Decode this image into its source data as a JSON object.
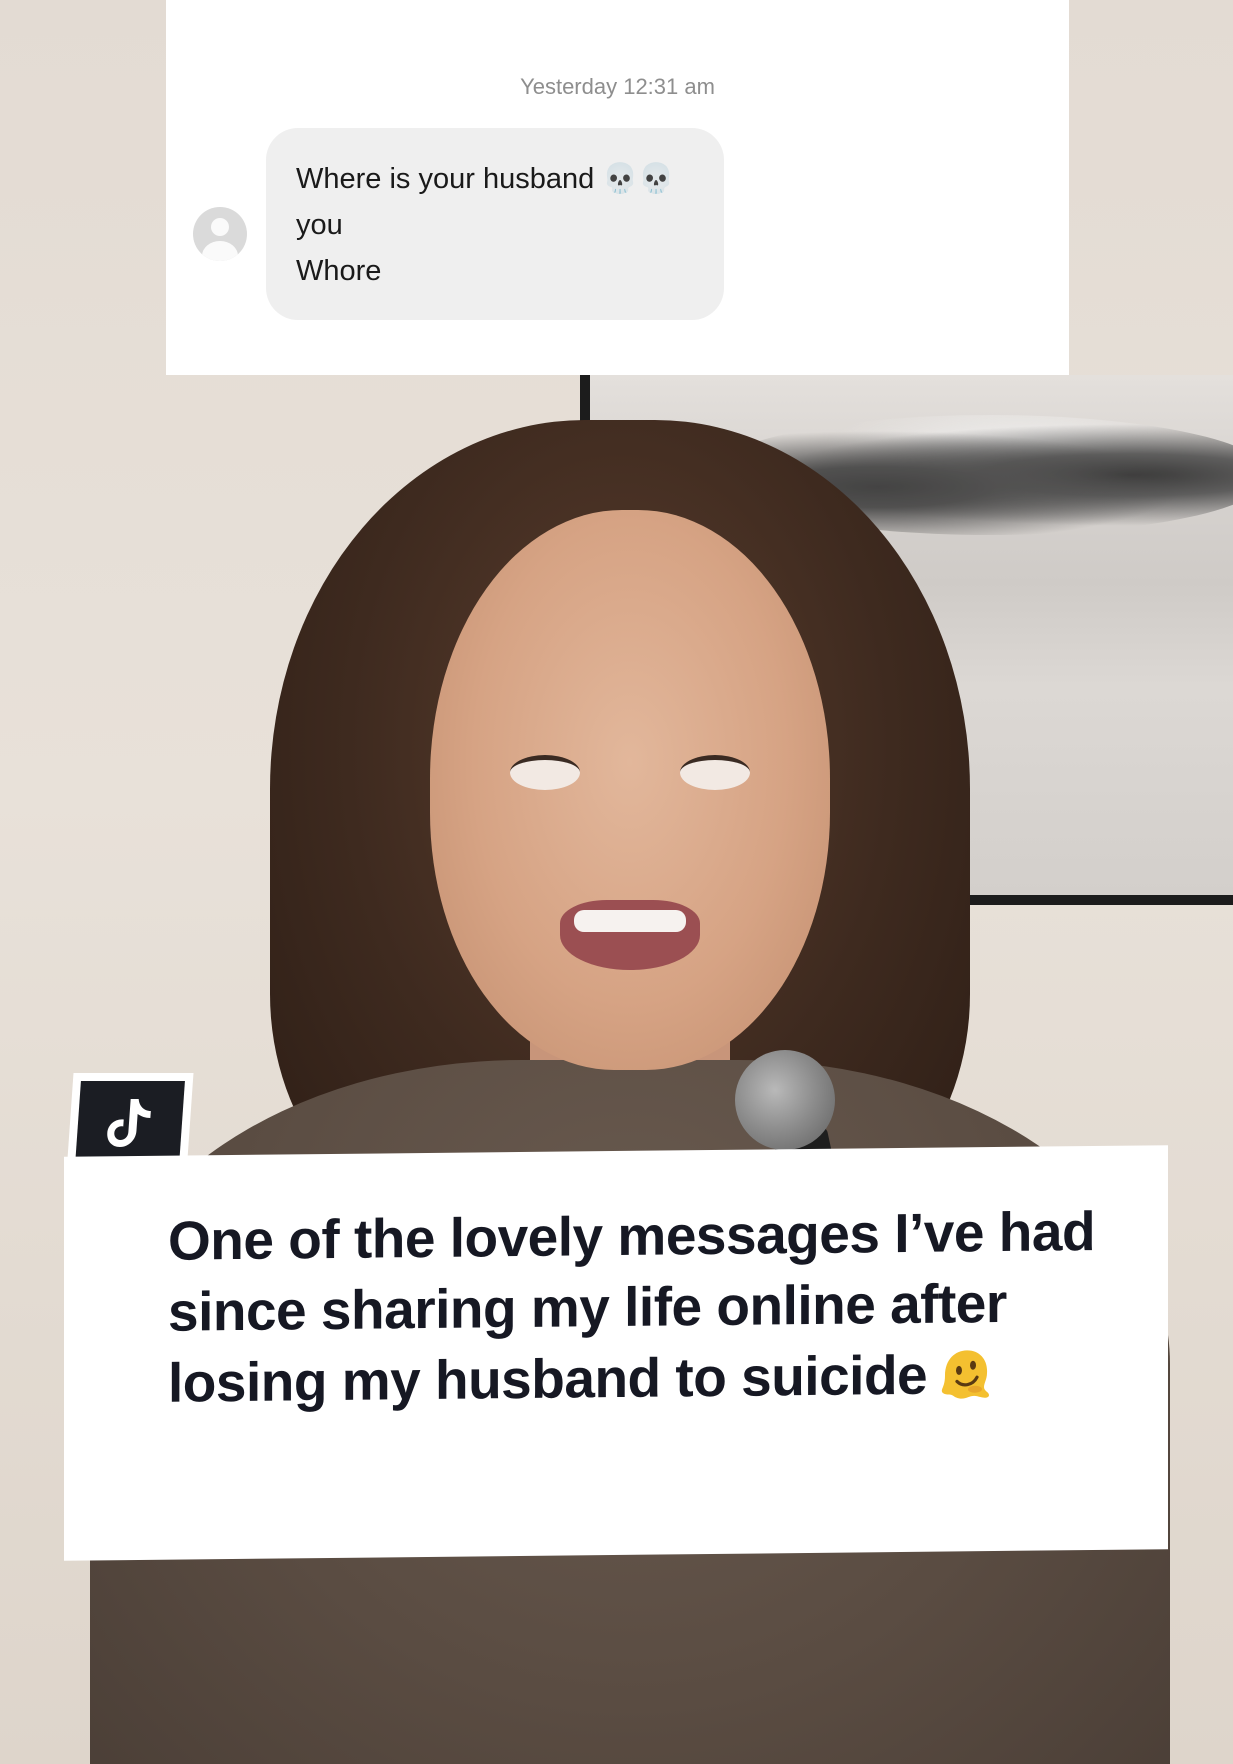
{
  "dm_screenshot": {
    "timestamp": "Yesterday 12:31 am",
    "message_line1": "Where is your husband 💀💀 you",
    "message_line2": "Whore"
  },
  "caption": {
    "text": "One of the lovely messages I’ve had since sharing my life online after losing my husband to suicide",
    "emoji": "melting-face-emoji"
  },
  "badge": {
    "icon": "tiktok-logo-icon"
  }
}
